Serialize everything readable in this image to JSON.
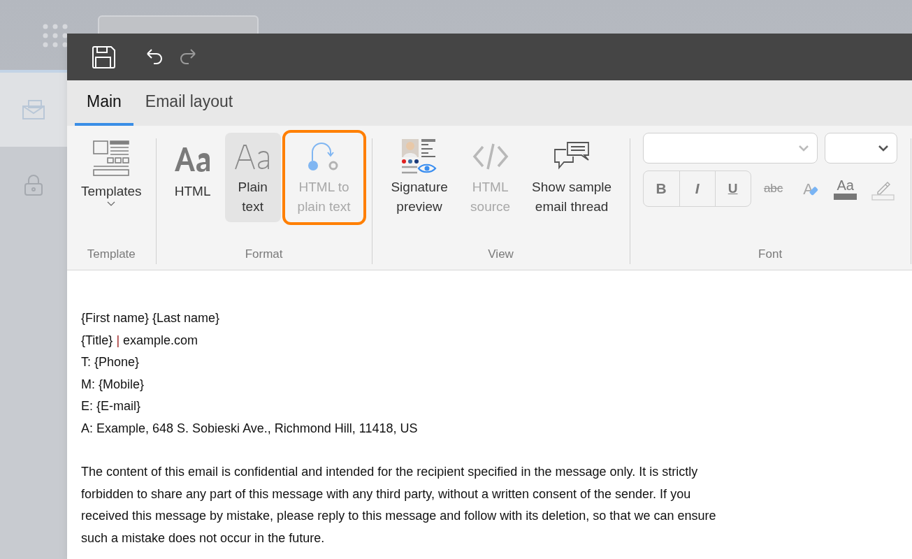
{
  "toolbar": {
    "buttons": [
      {
        "kind": "save",
        "disabled": false
      },
      {
        "kind": "undo",
        "disabled": false
      },
      {
        "kind": "redo",
        "disabled": true
      }
    ]
  },
  "tabs": [
    {
      "label": "Main",
      "selected": true
    },
    {
      "label": "Email layout",
      "selected": false
    }
  ],
  "ribbon": {
    "groups": [
      {
        "label": "Template",
        "buttons": [
          {
            "kind": "templates",
            "label": "Templates",
            "dropdown": true,
            "selected": false,
            "disabled": false,
            "highlighted": false
          }
        ]
      },
      {
        "label": "Format",
        "buttons": [
          {
            "kind": "html",
            "label": "HTML",
            "selected": false,
            "disabled": false,
            "highlighted": false
          },
          {
            "kind": "plain",
            "label": "Plain text",
            "selected": true,
            "disabled": false,
            "highlighted": false
          },
          {
            "kind": "convert",
            "label": "HTML to plain text",
            "selected": false,
            "disabled": true,
            "highlighted": true
          }
        ]
      },
      {
        "label": "View",
        "buttons": [
          {
            "kind": "preview",
            "label": "Signature preview",
            "selected": false,
            "disabled": false,
            "highlighted": false
          },
          {
            "kind": "source",
            "label": "HTML source",
            "selected": false,
            "disabled": true,
            "highlighted": false
          },
          {
            "kind": "thread",
            "label": "Show sample email thread",
            "selected": false,
            "disabled": false,
            "highlighted": false
          }
        ]
      }
    ],
    "font": {
      "label": "Font",
      "selects": [
        {
          "kind": "family",
          "disabled": true
        },
        {
          "kind": "size",
          "disabled": false
        }
      ],
      "buttons": [
        {
          "kind": "bold",
          "label": "B"
        },
        {
          "kind": "italic",
          "label": "I"
        },
        {
          "kind": "underline",
          "label": "U"
        },
        {
          "kind": "strike",
          "label": "abc"
        },
        {
          "kind": "clear",
          "label": "A"
        },
        {
          "kind": "color",
          "label": "Aa"
        },
        {
          "kind": "highlight"
        }
      ]
    }
  },
  "body": {
    "lines": [
      [
        {
          "text": "{First name} {Last name}",
          "accent": false
        }
      ],
      [
        {
          "text": "{Title} ",
          "accent": false
        },
        {
          "text": "|",
          "accent": true
        },
        {
          "text": " example.com",
          "accent": false
        }
      ],
      [
        {
          "text": "T: {Phone}",
          "accent": false
        }
      ],
      [
        {
          "text": "M: {Mobile}",
          "accent": false
        }
      ],
      [
        {
          "text": "E: {E-mail}",
          "accent": false
        }
      ],
      [
        {
          "text": "A: Example, 648 S. Sobieski Ave., Richmond Hill, 11418, US",
          "accent": false
        }
      ]
    ],
    "disclaimer": "The content of this email is confidential and intended for the recipient specified in the message only. It is strictly forbidden to share any part of this message with any third party, without a written consent of the sender. If you received this message by mistake, please reply to this message and follow with its deletion, so that we can ensure such a mistake does not occur in the future."
  }
}
